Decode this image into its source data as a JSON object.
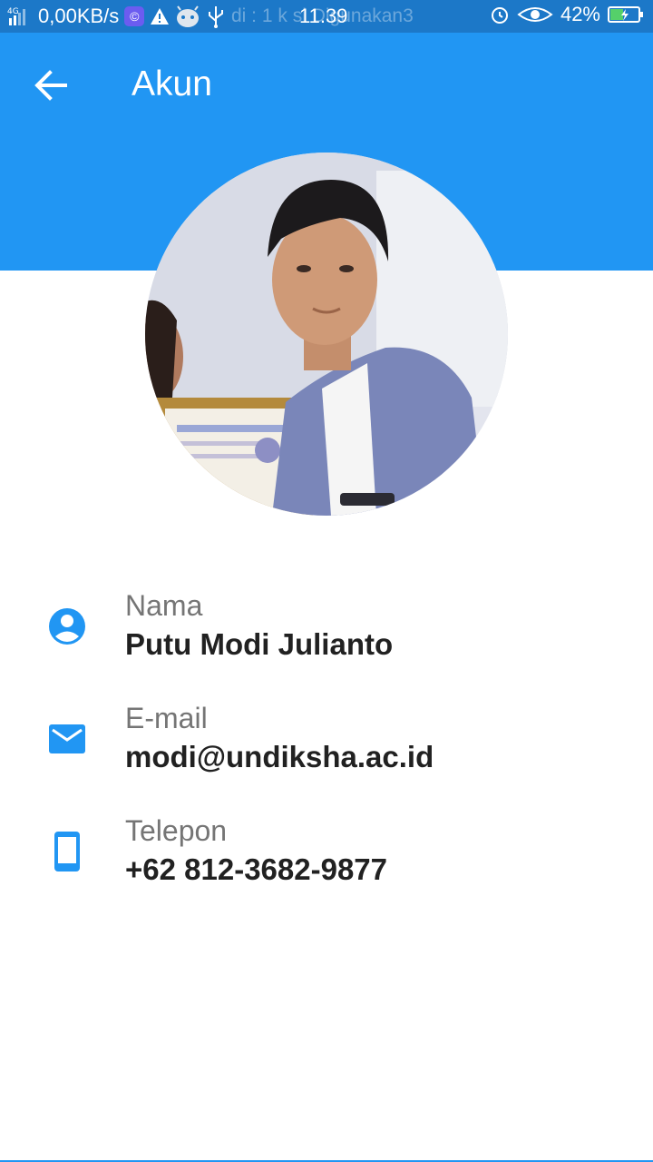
{
  "status_bar": {
    "network_type": "4G",
    "speed": "0,00KB/s",
    "ticker": "di : 1 k    si Digunakan3",
    "time": "11.39",
    "battery": "42%",
    "icons": [
      "signal-icon",
      "app-icon",
      "warning-icon",
      "android-icon",
      "usb-icon",
      "alarm-icon",
      "eye-icon",
      "battery-charging-icon"
    ]
  },
  "app_bar": {
    "title": "Akun",
    "back_icon": "arrow-back-icon",
    "color": "#2196f3"
  },
  "profile": {
    "avatar": "profile-photo",
    "fields": [
      {
        "icon": "account-circle-icon",
        "label": "Nama",
        "value": "Putu Modi Julianto"
      },
      {
        "icon": "email-icon",
        "label": "E-mail",
        "value": "modi@undiksha.ac.id"
      },
      {
        "icon": "smartphone-icon",
        "label": "Telepon",
        "value": "+62 812-3682-9877"
      }
    ]
  },
  "colors": {
    "accent": "#2196f3",
    "status_bar": "#1c78c8",
    "label": "#757575",
    "value": "#212121"
  }
}
